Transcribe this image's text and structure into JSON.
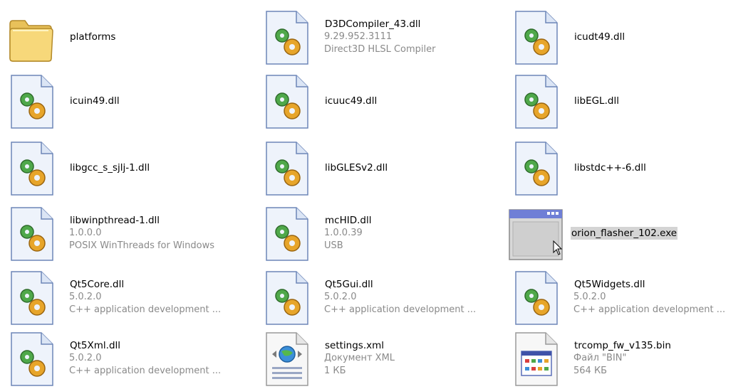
{
  "items": [
    {
      "icon": "folder-icon",
      "name": "platforms",
      "version": "",
      "description": ""
    },
    {
      "icon": "dll-icon",
      "name": "D3DCompiler_43.dll",
      "version": "9.29.952.3111",
      "description": "Direct3D HLSL Compiler"
    },
    {
      "icon": "dll-icon",
      "name": "icudt49.dll",
      "version": "",
      "description": ""
    },
    {
      "icon": "dll-icon",
      "name": "icuin49.dll",
      "version": "",
      "description": ""
    },
    {
      "icon": "dll-icon",
      "name": "icuuc49.dll",
      "version": "",
      "description": ""
    },
    {
      "icon": "dll-icon",
      "name": "libEGL.dll",
      "version": "",
      "description": ""
    },
    {
      "icon": "dll-icon",
      "name": "libgcc_s_sjlj-1.dll",
      "version": "",
      "description": ""
    },
    {
      "icon": "dll-icon",
      "name": "libGLESv2.dll",
      "version": "",
      "description": ""
    },
    {
      "icon": "dll-icon",
      "name": "libstdc++-6.dll",
      "version": "",
      "description": ""
    },
    {
      "icon": "dll-icon",
      "name": "libwinpthread-1.dll",
      "version": "1.0.0.0",
      "description": "POSIX WinThreads for Windows"
    },
    {
      "icon": "dll-icon",
      "name": "mcHID.dll",
      "version": "1.0.0.39",
      "description": "USB"
    },
    {
      "icon": "exe-window-icon",
      "name": "orion_flasher_102.exe",
      "version": "",
      "description": "",
      "selected": true
    },
    {
      "icon": "dll-icon",
      "name": "Qt5Core.dll",
      "version": "5.0.2.0",
      "description": "C++ application development ..."
    },
    {
      "icon": "dll-icon",
      "name": "Qt5Gui.dll",
      "version": "5.0.2.0",
      "description": "C++ application development ..."
    },
    {
      "icon": "dll-icon",
      "name": "Qt5Widgets.dll",
      "version": "5.0.2.0",
      "description": "C++ application development ..."
    },
    {
      "icon": "dll-icon",
      "name": "Qt5Xml.dll",
      "version": "5.0.2.0",
      "description": "C++ application development ..."
    },
    {
      "icon": "xml-file-icon",
      "name": "settings.xml",
      "version": "Документ XML",
      "description": "1 КБ"
    },
    {
      "icon": "bin-file-icon",
      "name": "trcomp_fw_v135.bin",
      "version": "Файл \"BIN\"",
      "description": "564 КБ"
    }
  ],
  "cursor": "mouse-pointer-icon"
}
